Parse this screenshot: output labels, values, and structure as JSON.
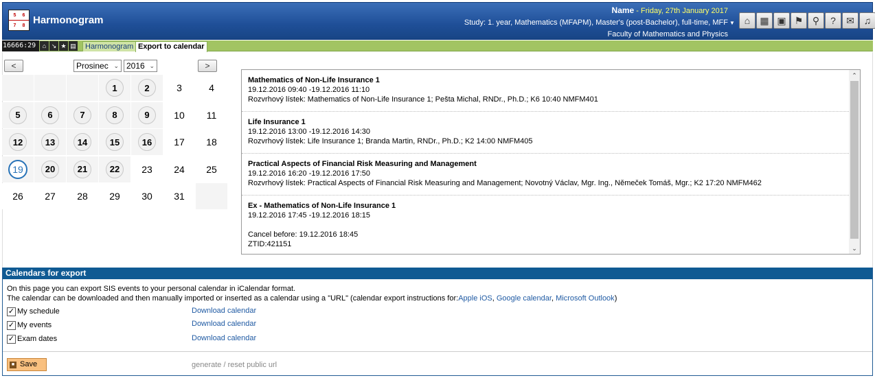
{
  "app": {
    "title": "Harmonogram",
    "logo_digits": [
      "5",
      "6",
      "7",
      "8"
    ]
  },
  "user": {
    "name": "Name",
    "date_separator": "-",
    "date": "Friday, 27th January 2017",
    "study": "Study: 1. year, Mathematics (MFAPM), Master's (post-Bachelor), full-time, MFF",
    "faculty": "Faculty of Mathematics and Physics"
  },
  "toolbar_icons": [
    "home-icon",
    "schedule-icon",
    "lock-icon",
    "flag-icon",
    "search-icon",
    "help-icon",
    "feedback-icon",
    "bell-icon"
  ],
  "nav": {
    "counter": "16666:29",
    "icons": [
      "home-icon",
      "arrow-icon",
      "star-icon",
      "print-icon"
    ],
    "breadcrumb_1": "Harmonogram",
    "breadcrumb_2": "Export to calendar"
  },
  "calendar": {
    "prev": "<",
    "next": ">",
    "month": "Prosinec",
    "year": "2016",
    "weeks": [
      [
        "",
        "",
        "",
        "1",
        "2",
        "3",
        "4"
      ],
      [
        "5",
        "6",
        "7",
        "8",
        "9",
        "10",
        "11"
      ],
      [
        "12",
        "13",
        "14",
        "15",
        "16",
        "17",
        "18"
      ],
      [
        "19",
        "20",
        "21",
        "22",
        "23",
        "24",
        "25"
      ],
      [
        "26",
        "27",
        "28",
        "29",
        "30",
        "31",
        ""
      ]
    ],
    "event_days": [
      "1",
      "2",
      "5",
      "6",
      "7",
      "8",
      "9",
      "12",
      "13",
      "14",
      "15",
      "16",
      "20",
      "21",
      "22"
    ],
    "selected_day": "19"
  },
  "events": [
    {
      "title": "Mathematics of Non-Life Insurance 1",
      "time": "19.12.2016 09:40 -19.12.2016 11:10",
      "detail": "Rozvrhový lístek: Mathematics of Non-Life Insurance 1; Pešta Michal, RNDr., Ph.D.; K6 10:40 NMFM401"
    },
    {
      "title": "Life Insurance 1",
      "time": "19.12.2016 13:00 -19.12.2016 14:30",
      "detail": "Rozvrhový lístek: Life Insurance 1; Branda Martin, RNDr., Ph.D.; K2 14:00 NMFM405"
    },
    {
      "title": "Practical Aspects of Financial Risk Measuring and Management",
      "time": "19.12.2016 16:20 -19.12.2016 17:50",
      "detail": "Rozvrhový lístek: Practical Aspects of Financial Risk Measuring and Management; Novotný Václav, Mgr. Ing., Němeček Tomáš, Mgr.; K2 17:20 NMFM462"
    },
    {
      "title": "Ex - Mathematics of Non-Life Insurance 1",
      "time": "19.12.2016 17:45 -19.12.2016 18:15",
      "cancel": "Cancel before: 19.12.2016 18:45",
      "ztid": "ZTID:421151"
    }
  ],
  "export": {
    "heading": "Calendars for export",
    "line1": "On this page you can export SIS events to your personal calendar in iCalendar format.",
    "line2": "The calendar can be downloaded and then manually imported or inserted as a calendar using a \"URL\" (calendar export instructions for:",
    "link_apple": "Apple iOS",
    "comma1": ",",
    "link_google": "Google calendar",
    "comma2": ",",
    "link_ms": "Microsoft Outlook",
    "close_paren": ")",
    "items": [
      {
        "label": "My schedule",
        "checked": true,
        "link": "Download calendar"
      },
      {
        "label": "My events",
        "checked": true,
        "link": "Download calendar"
      },
      {
        "label": "Exam dates",
        "checked": true,
        "link": "Download calendar"
      }
    ],
    "save": "Save",
    "regen": "generate / reset public url"
  }
}
